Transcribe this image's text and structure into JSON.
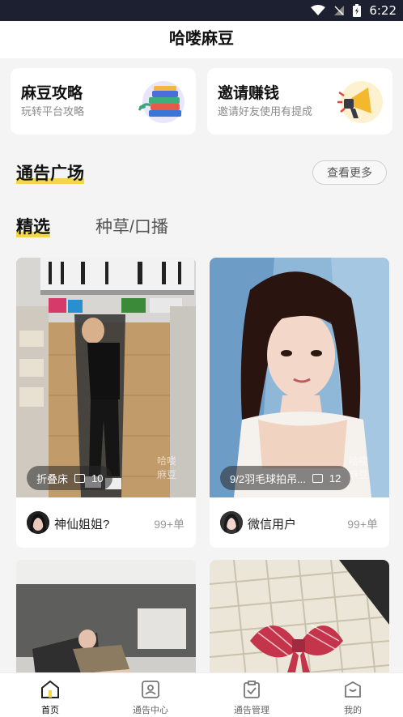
{
  "status_bar": {
    "time": "6:22"
  },
  "header": {
    "title": "哈喽麻豆"
  },
  "promo_cards": [
    {
      "title": "麻豆攻略",
      "subtitle": "玩转平台攻略",
      "icon": "books-icon"
    },
    {
      "title": "邀请赚钱",
      "subtitle": "邀请好友使用有提成",
      "icon": "megaphone-icon"
    }
  ],
  "section": {
    "title": "通告广场",
    "more_label": "查看更多"
  },
  "tabs": [
    {
      "label": "精选",
      "active": true
    },
    {
      "label": "种草/口播",
      "active": false
    }
  ],
  "feed": [
    {
      "tag": "折叠床",
      "image_count": "10",
      "user": "神仙姐姐?",
      "orders": "99+单"
    },
    {
      "tag": "9/2羽毛球拍吊...",
      "image_count": "12",
      "user": "微信用户",
      "orders": "99+单"
    },
    {
      "tag": "",
      "image_count": "",
      "user": "",
      "orders": ""
    },
    {
      "tag": "",
      "image_count": "",
      "user": "",
      "orders": ""
    }
  ],
  "watermark": "哈喽麻豆",
  "bottom_nav": [
    {
      "label": "首页",
      "icon": "home-icon",
      "active": true
    },
    {
      "label": "通告中心",
      "icon": "notice-center-icon",
      "active": false
    },
    {
      "label": "通告管理",
      "icon": "clipboard-check-icon",
      "active": false
    },
    {
      "label": "我的",
      "icon": "profile-bag-icon",
      "active": false
    }
  ],
  "colors": {
    "accent_yellow": "#f6d54a",
    "status_bar": "#1c2030",
    "background": "#f4f4f4"
  }
}
